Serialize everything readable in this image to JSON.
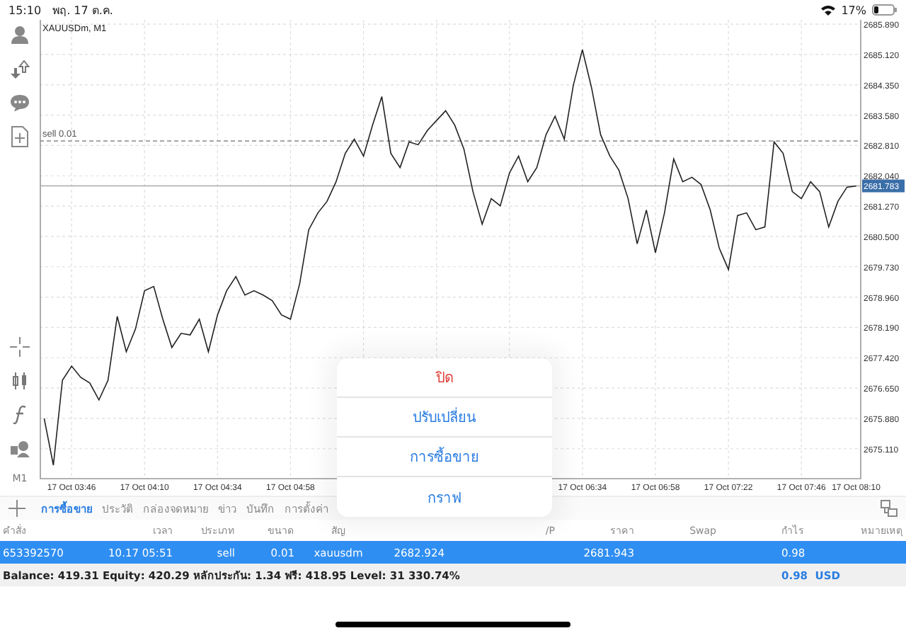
{
  "status_bar": {
    "time": "15:10",
    "date": "พฤ. 17 ต.ค.",
    "battery": "17%"
  },
  "chart": {
    "title": "XAUUSDm, M1",
    "chart_data": {
      "type": "line",
      "categories": [
        null,
        null,
        null,
        "17 Oct 03:46",
        null,
        null,
        null,
        null,
        null,
        null,
        null,
        "17 Oct 04:10",
        null,
        null,
        null,
        null,
        null,
        null,
        null,
        "17 Oct 04:34",
        null,
        null,
        null,
        null,
        null,
        null,
        null,
        "17 Oct 04:58",
        null,
        null,
        null,
        null,
        null,
        null,
        null,
        null,
        null,
        null,
        null,
        null,
        null,
        null,
        null,
        null,
        null,
        null,
        null,
        null,
        null,
        null,
        null,
        null,
        null,
        null,
        null,
        null,
        null,
        null,
        null,
        "17 Oct 06:34",
        null,
        null,
        null,
        null,
        null,
        null,
        null,
        "17 Oct 06:58",
        null,
        null,
        null,
        null,
        null,
        null,
        null,
        "17 Oct 07:22",
        null,
        null,
        null,
        null,
        null,
        null,
        null,
        "17 Oct 07:46",
        null,
        null,
        null,
        null,
        null,
        "17 Oct 08:10"
      ],
      "series": [
        {
          "color": "#222222",
          "values": [
            2675.88,
            2674.69,
            2676.85,
            2677.21,
            2676.92,
            2676.78,
            2676.35,
            2676.85,
            2678.47,
            2677.57,
            2678.15,
            2679.12,
            2679.23,
            2678.4,
            2677.68,
            2678.04,
            2678.0,
            2678.4,
            2677.57,
            2678.51,
            2679.12,
            2679.48,
            2679.01,
            2679.12,
            2679.01,
            2678.87,
            2678.51,
            2678.4,
            2679.3,
            2680.67,
            2681.1,
            2681.39,
            2681.89,
            2682.61,
            2682.97,
            2682.54,
            2683.33,
            2684.05,
            2682.61,
            2682.25,
            2682.9,
            2682.83,
            2683.19,
            2683.44,
            2683.69,
            2683.33,
            2682.72,
            2681.64,
            2680.81,
            2681.46,
            2681.28,
            2682.11,
            2682.54,
            2681.89,
            2682.25,
            2683.08,
            2683.55,
            2682.97,
            2684.34,
            2685.24,
            2684.27,
            2683.08,
            2682.54,
            2682.18,
            2681.46,
            2680.31,
            2681.17,
            2680.09,
            2681.1,
            2682.47,
            2681.89,
            2682.0,
            2681.82,
            2681.17,
            2680.2,
            2679.66,
            2681.03,
            2681.1,
            2680.67,
            2680.74,
            2682.9,
            2682.61,
            2681.64,
            2681.46,
            2681.89,
            2681.64,
            2680.74,
            2681.39,
            2681.75,
            2681.78
          ]
        }
      ],
      "grid": true,
      "ylim": [
        2674.35,
        2686.0
      ],
      "yticks": [
        {
          "value": 2685.89,
          "label": "2685.890"
        },
        {
          "value": 2685.12,
          "label": "2685.120"
        },
        {
          "value": 2684.35,
          "label": "2684.350"
        },
        {
          "value": 2683.58,
          "label": "2683.580"
        },
        {
          "value": 2682.81,
          "label": "2682.810"
        },
        {
          "value": 2682.04,
          "label": "2682.040"
        },
        {
          "value": 2681.27,
          "label": "2681.270"
        },
        {
          "value": 2680.5,
          "label": "2680.500"
        },
        {
          "value": 2679.73,
          "label": "2679.730"
        },
        {
          "value": 2678.96,
          "label": "2678.960"
        },
        {
          "value": 2678.19,
          "label": "2678.190"
        },
        {
          "value": 2677.42,
          "label": "2677.420"
        },
        {
          "value": 2676.65,
          "label": "2676.650"
        },
        {
          "value": 2675.88,
          "label": "2675.880"
        },
        {
          "value": 2675.11,
          "label": "2675.110"
        }
      ],
      "ref_lines": [
        {
          "axis": "y",
          "value": 2682.924,
          "label": "sell 0.01"
        },
        {
          "axis": "y",
          "value": 2681.783,
          "label": "2681.783"
        }
      ]
    }
  },
  "left_toolbar": {
    "timeframe": "M1"
  },
  "tabs": [
    {
      "label": "การซื้อขาย",
      "selected": true
    },
    {
      "label": "ประวัติ",
      "selected": false
    },
    {
      "label": "กล่องจดหมาย",
      "selected": false
    },
    {
      "label": "ข่าว",
      "selected": false
    },
    {
      "label": "บันทึก",
      "selected": false
    },
    {
      "label": "การตั้งค่า",
      "selected": false
    }
  ],
  "table": {
    "columns": [
      "คำสั่ง",
      "เวลา",
      "ประเภท",
      "ขนาด",
      "สัญ",
      null,
      null,
      "/P",
      "ราคา",
      "Swap",
      "กำไร",
      "หมายเหตุ"
    ],
    "rows": [
      {
        "selected": true,
        "cells": [
          "653392570",
          "10.17 05:51",
          "sell",
          "0.01",
          "xauusdm",
          "2682.924",
          null,
          null,
          "2681.943",
          null,
          "0.98",
          null
        ]
      }
    ]
  },
  "summary": {
    "text": "Balance: 419.31 Equity: 420.29 หลักประกัน: 1.34 ฟรี: 418.95 Level: 31 330.74%",
    "profit": "0.98",
    "currency": "USD"
  },
  "action_sheet": {
    "items": [
      {
        "label": "ปิด",
        "kind": "destructive"
      },
      {
        "label": "ปรับเปลี่ยน",
        "kind": "default"
      },
      {
        "label": "การซื้อขาย",
        "kind": "default"
      },
      {
        "label": "กราฟ",
        "kind": "default"
      }
    ]
  }
}
